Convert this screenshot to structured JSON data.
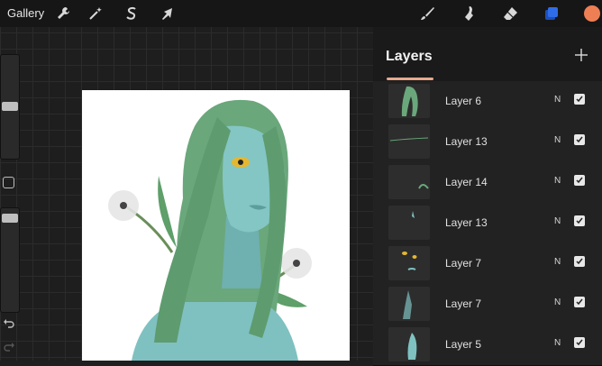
{
  "toolbar": {
    "gallery_label": "Gallery",
    "left_icons": [
      "wrench-icon",
      "magic-wand-icon",
      "selection-s-icon",
      "arrow-cursor-icon"
    ],
    "right_icons": [
      "brush-icon",
      "smudge-icon",
      "eraser-icon",
      "layers-icon",
      "color-swatch-icon"
    ],
    "active_color": "#ee7f55",
    "layers_icon_color": "#2f6de8"
  },
  "sidebar": {
    "brush_size_level": 0.3,
    "opacity_level": 0.1
  },
  "layers_panel": {
    "title": "Layers",
    "add_icon": "plus-icon",
    "layers": [
      {
        "name": "Layer 6",
        "mode": "N",
        "visible": true
      },
      {
        "name": "Layer 13",
        "mode": "N",
        "visible": true
      },
      {
        "name": "Layer 14",
        "mode": "N",
        "visible": true
      },
      {
        "name": "Layer 13",
        "mode": "N",
        "visible": true
      },
      {
        "name": "Layer 7",
        "mode": "N",
        "visible": true
      },
      {
        "name": "Layer 7",
        "mode": "N",
        "visible": true
      },
      {
        "name": "Layer 5",
        "mode": "N",
        "visible": true
      }
    ]
  },
  "colors": {
    "hair": "#6aa77b",
    "skin": "#7fc1c1",
    "leaf": "#5e9f6a",
    "accent_underline": "#e6a98f"
  }
}
